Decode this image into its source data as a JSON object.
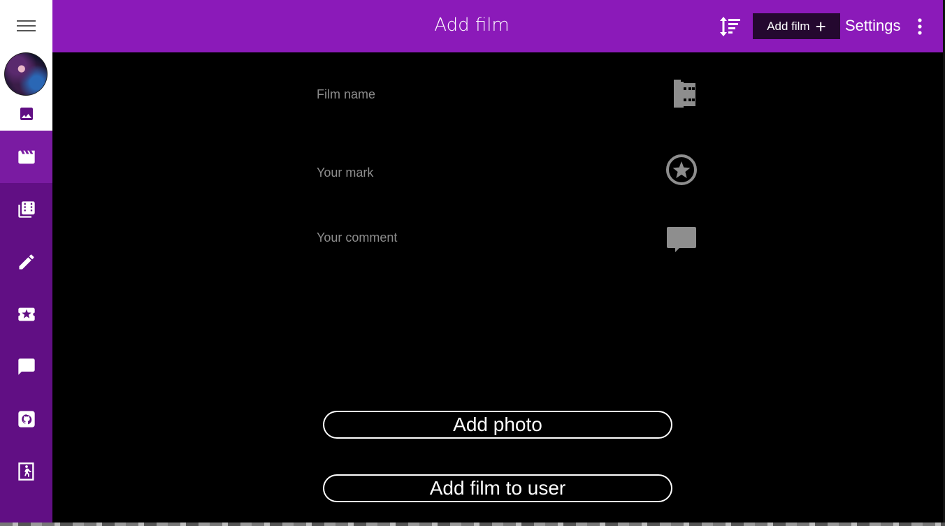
{
  "header": {
    "title": "Add film",
    "add_film_label": "Add film",
    "add_film_plus": "+",
    "settings_label": "Settings"
  },
  "sidebar": {
    "items": [
      {
        "icon": "clapperboard-icon",
        "active": true
      },
      {
        "icon": "film-library-icon",
        "active": false
      },
      {
        "icon": "pencil-icon",
        "active": false
      },
      {
        "icon": "ticket-star-icon",
        "active": false
      },
      {
        "icon": "comment-icon",
        "active": false
      },
      {
        "icon": "github-icon",
        "active": false
      },
      {
        "icon": "exit-icon",
        "active": false
      }
    ]
  },
  "form": {
    "film_name_label": "Film name",
    "mark_label": "Your mark",
    "comment_label": "Your comment",
    "add_photo_label": "Add photo",
    "add_film_to_user_label": "Add film to user"
  },
  "colors": {
    "header": "#8b1ab9",
    "sidebar": "#610f84",
    "sidebar_active": "#7a1ba2",
    "add_button": "#24082f",
    "background": "#000000",
    "label": "#8d8d8d"
  }
}
